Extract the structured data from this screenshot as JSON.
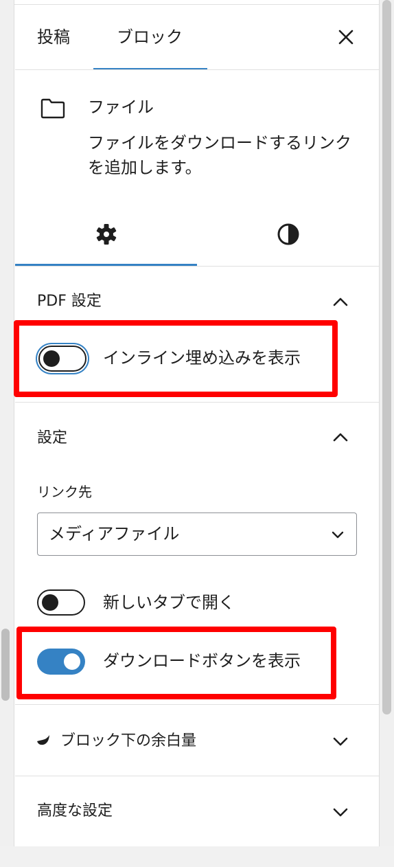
{
  "tabs": {
    "post": "投稿",
    "block": "ブロック"
  },
  "block": {
    "title": "ファイル",
    "description": "ファイルをダウンロードするリンクを追加します。"
  },
  "pdf_section": {
    "title": "PDF 設定",
    "inline_embed_label": "インライン埋め込みを表示",
    "inline_embed_on": false
  },
  "settings_section": {
    "title": "設定",
    "link_to_label": "リンク先",
    "link_to_value": "メディアファイル",
    "new_tab_label": "新しいタブで開く",
    "new_tab_on": false,
    "download_button_label": "ダウンロードボタンを表示",
    "download_button_on": true
  },
  "spacing_section": {
    "title": "ブロック下の余白量"
  },
  "advanced_section": {
    "title": "高度な設定"
  },
  "colors": {
    "accent": "#3582c4",
    "highlight": "#ff0000",
    "text": "#1e1e1e"
  }
}
